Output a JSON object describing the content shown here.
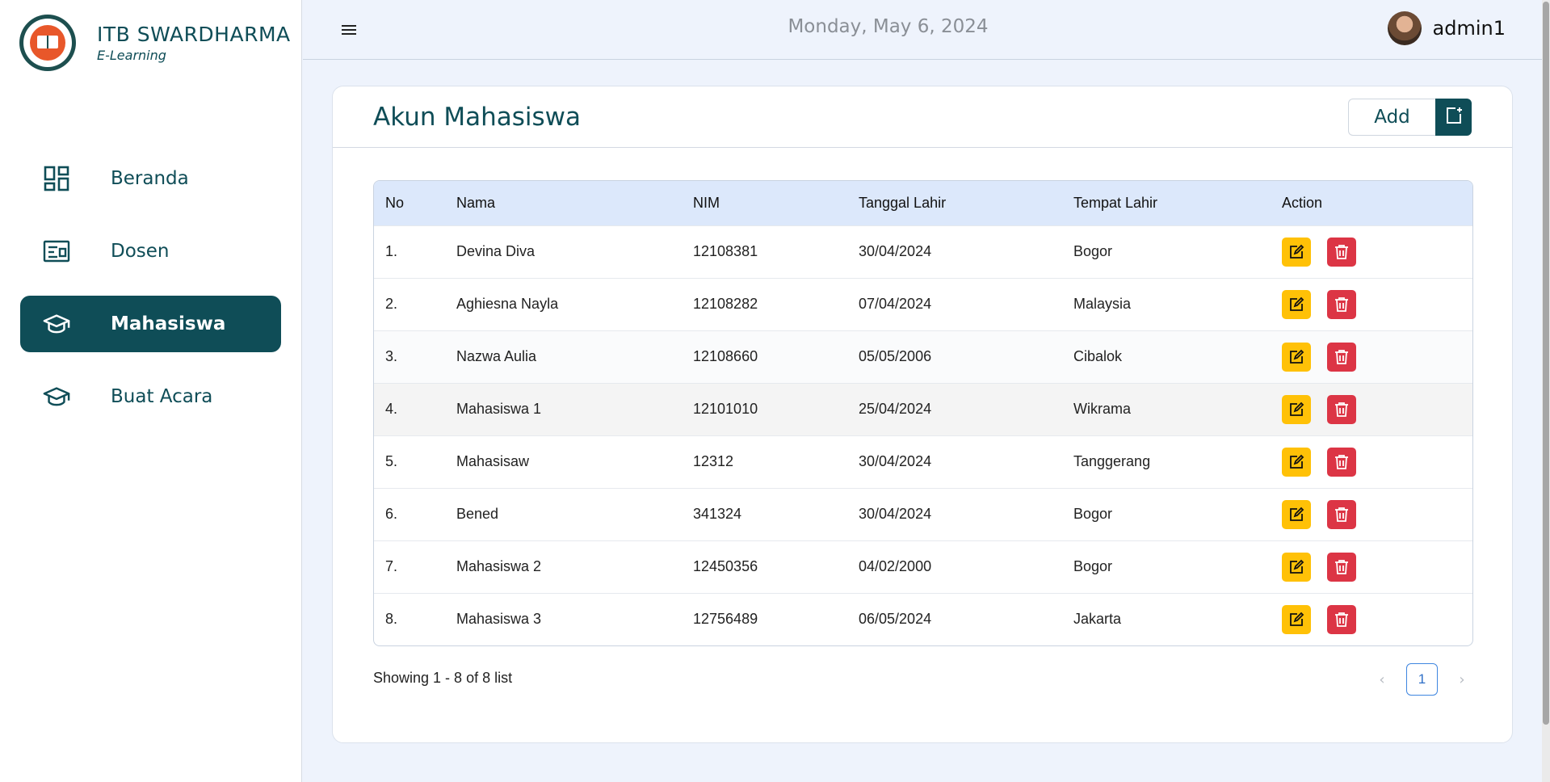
{
  "brand": {
    "title": "ITB SWARDHARMA",
    "subtitle": "E-Learning"
  },
  "sidebar": {
    "items": [
      {
        "label": "Beranda",
        "icon": "dashboard-icon",
        "active": false
      },
      {
        "label": "Dosen",
        "icon": "id-card-icon",
        "active": false
      },
      {
        "label": "Mahasiswa",
        "icon": "graduation-cap-icon",
        "active": true
      },
      {
        "label": "Buat Acara",
        "icon": "graduation-cap-icon",
        "active": false
      }
    ]
  },
  "topbar": {
    "date": "Monday, May 6, 2024",
    "username": "admin1"
  },
  "card": {
    "title": "Akun Mahasiswa",
    "add_label": "Add"
  },
  "table": {
    "headers": [
      "No",
      "Nama",
      "NIM",
      "Tanggal Lahir",
      "Tempat Lahir",
      "Action"
    ],
    "rows": [
      [
        "1.",
        "Devina Diva",
        "12108381",
        "30/04/2024",
        "Bogor"
      ],
      [
        "2.",
        "Aghiesna Nayla",
        "12108282",
        "07/04/2024",
        "Malaysia"
      ],
      [
        "3.",
        "Nazwa Aulia",
        "12108660",
        "05/05/2006",
        "Cibalok"
      ],
      [
        "4.",
        "Mahasiswa 1",
        "12101010",
        "25/04/2024",
        "Wikrama"
      ],
      [
        "5.",
        "Mahasisaw",
        "12312",
        "30/04/2024",
        "Tanggerang"
      ],
      [
        "6.",
        "Bened",
        "341324",
        "30/04/2024",
        "Bogor"
      ],
      [
        "7.",
        "Mahasiswa 2",
        "12450356",
        "04/02/2000",
        "Bogor"
      ],
      [
        "8.",
        "Mahasiswa 3",
        "12756489",
        "06/05/2024",
        "Jakarta"
      ]
    ]
  },
  "footer": {
    "showing": "Showing 1 - 8 of 8 list"
  },
  "pagination": {
    "prev": "‹",
    "current": "1",
    "next": "›"
  },
  "colors": {
    "primary": "#0f4d57",
    "edit": "#ffc107",
    "delete": "#dc3545",
    "header_bg": "#dce8fb"
  }
}
